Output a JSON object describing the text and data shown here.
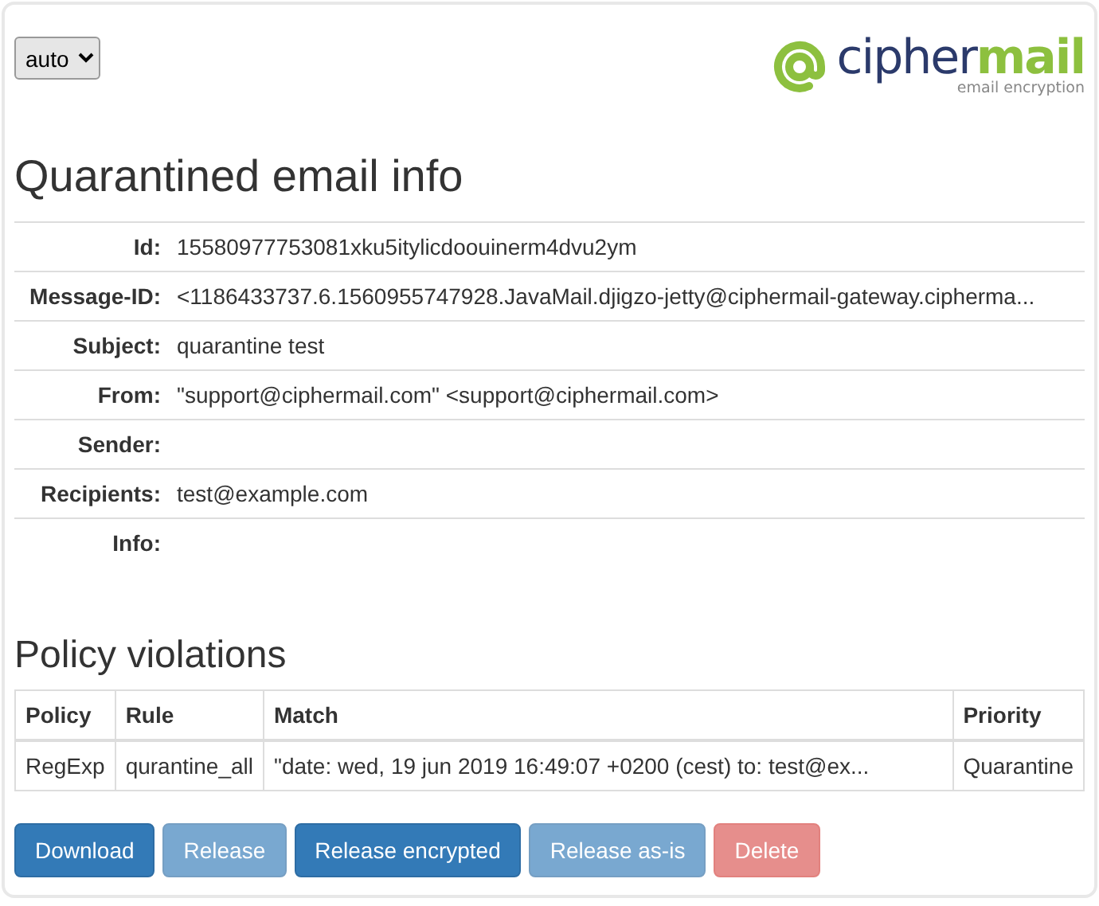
{
  "language_select": {
    "value": "auto"
  },
  "logo": {
    "word_1": "cipher",
    "word_2": "mail",
    "tagline": "email encryption"
  },
  "title": "Quarantined email info",
  "info": [
    {
      "label": "Id:",
      "value": "15580977753081xku5itylicdoouinerm4dvu2ym"
    },
    {
      "label": "Message-ID:",
      "value": "<1186433737.6.1560955747928.JavaMail.djigzo-jetty@ciphermail-gateway.cipherma..."
    },
    {
      "label": "Subject:",
      "value": "quarantine test"
    },
    {
      "label": "From:",
      "value": "\"support@ciphermail.com\" <support@ciphermail.com>"
    },
    {
      "label": "Sender:"
    },
    {
      "label": "Recipients:",
      "value": "test@example.com"
    },
    {
      "label": "Info:"
    }
  ],
  "violations": {
    "title": "Policy violations",
    "columns": [
      "Policy",
      "Rule",
      "Match",
      "Priority"
    ],
    "rows": [
      [
        "RegExp",
        "qurantine_all",
        "\"date: wed, 19 jun 2019 16:49:07 +0200 (cest) to: test@ex...",
        "Quarantine"
      ]
    ]
  },
  "buttons": [
    {
      "label": "Download",
      "kind": "primary",
      "disabled": false
    },
    {
      "label": "Release",
      "kind": "primary",
      "disabled": true
    },
    {
      "label": "Release encrypted",
      "kind": "primary",
      "disabled": false
    },
    {
      "label": "Release as-is",
      "kind": "primary",
      "disabled": true
    },
    {
      "label": "Delete",
      "kind": "danger",
      "disabled": true
    }
  ]
}
